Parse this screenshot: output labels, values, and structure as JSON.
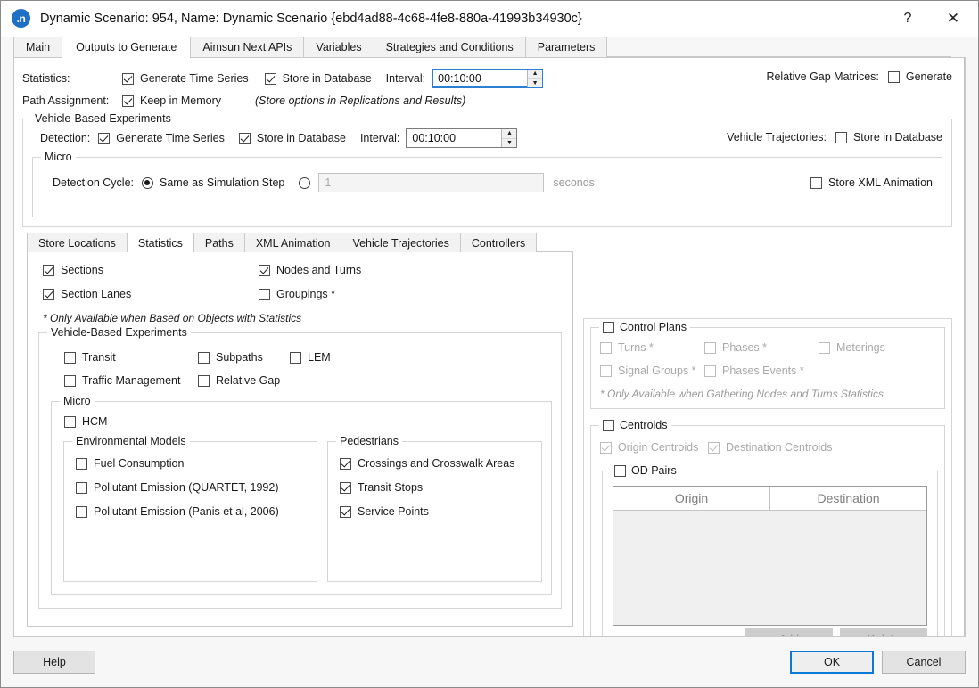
{
  "titlebar": {
    "icon": "aimsun-n-icon",
    "title": "Dynamic Scenario: 954, Name: Dynamic Scenario  {ebd4ad88-4c68-4fe8-880a-41993b34930c}",
    "help_glyph": "?",
    "close_glyph": "✕"
  },
  "tabs": [
    {
      "label": "Main",
      "active": false
    },
    {
      "label": "Outputs to Generate",
      "active": true
    },
    {
      "label": "Aimsun Next APIs",
      "active": false
    },
    {
      "label": "Variables",
      "active": false
    },
    {
      "label": "Strategies and Conditions",
      "active": false
    },
    {
      "label": "Parameters",
      "active": false
    }
  ],
  "top": {
    "statistics_label": "Statistics:",
    "statistics_generate_ts": "Generate Time Series",
    "statistics_store_db": "Store in Database",
    "statistics_interval_label": "Interval:",
    "statistics_interval_value": "00:10:00",
    "path_assignment_label": "Path Assignment:",
    "keep_in_memory": "Keep in Memory",
    "store_options_note": "(Store options in Replications and Results)",
    "relative_gap_label": "Relative Gap Matrices:",
    "relative_gap_generate": "Generate"
  },
  "vbe": {
    "title": "Vehicle-Based Experiments",
    "detection_label": "Detection:",
    "detection_generate_ts": "Generate Time Series",
    "detection_store_db": "Store in Database",
    "detection_interval_label": "Interval:",
    "detection_interval_value": "00:10:00",
    "vehicle_trajectories_label": "Vehicle Trajectories:",
    "vehicle_trajectories_store_db": "Store in Database",
    "micro_title": "Micro",
    "detection_cycle_label": "Detection Cycle:",
    "same_as_sim_step": "Same as Simulation Step",
    "custom_cycle_value": "1",
    "seconds_label": "seconds",
    "store_xml_animation": "Store XML Animation"
  },
  "inner_tabs": [
    {
      "label": "Store Locations",
      "active": false
    },
    {
      "label": "Statistics",
      "active": true
    },
    {
      "label": "Paths",
      "active": false
    },
    {
      "label": "XML Animation",
      "active": false
    },
    {
      "label": "Vehicle Trajectories",
      "active": false
    },
    {
      "label": "Controllers",
      "active": false
    }
  ],
  "statistics_tab": {
    "sections": "Sections",
    "section_lanes": "Section Lanes",
    "nodes_and_turns": "Nodes and Turns",
    "groupings": "Groupings *",
    "footnote": "* Only Available when Based on Objects with Statistics",
    "vbe_group_title": "Vehicle-Based Experiments",
    "transit": "Transit",
    "subpaths": "Subpaths",
    "lem": "LEM",
    "traffic_management": "Traffic Management",
    "relative_gap": "Relative Gap",
    "micro_title": "Micro",
    "hcm": "HCM",
    "env_models_title": "Environmental Models",
    "fuel_consumption": "Fuel Consumption",
    "pollutant_quartet": "Pollutant Emission (QUARTET, 1992)",
    "pollutant_panis": "Pollutant Emission (Panis et al, 2006)",
    "pedestrians_title": "Pedestrians",
    "crossings": "Crossings and Crosswalk Areas",
    "transit_stops": "Transit Stops",
    "service_points": "Service Points"
  },
  "control_plans": {
    "title": "Control Plans",
    "turns": "Turns *",
    "phases": "Phases *",
    "meterings": "Meterings",
    "signal_groups": "Signal Groups *",
    "phases_events": "Phases Events *",
    "footnote": "* Only Available when Gathering Nodes and Turns Statistics"
  },
  "centroids": {
    "title": "Centroids",
    "origin_centroids": "Origin Centroids",
    "destination_centroids": "Destination Centroids",
    "od_pairs_title": "OD Pairs",
    "table": {
      "columns": [
        "Origin",
        "Destination"
      ],
      "rows": []
    },
    "add_label": "Add",
    "delete_label": "Delete"
  },
  "footer": {
    "help": "Help",
    "ok": "OK",
    "cancel": "Cancel"
  },
  "colors": {
    "accent": "#0b7ad6",
    "app_icon": "#1f6fc4",
    "panel_bg": "#ffffff",
    "window_bg": "#f7f7f7"
  }
}
